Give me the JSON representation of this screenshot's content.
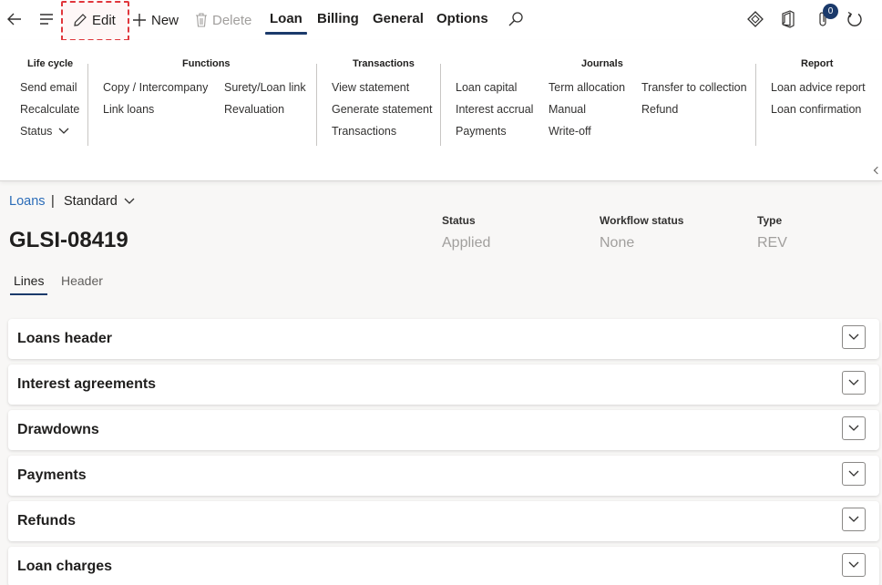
{
  "toolbar": {
    "edit_label": "Edit",
    "new_label": "New",
    "delete_label": "Delete",
    "tabs": [
      "Loan",
      "Billing",
      "General",
      "Options"
    ],
    "notification_count": "0"
  },
  "ribbon": {
    "groups": {
      "lifecycle": {
        "title": "Life cycle",
        "items": [
          "Send email",
          "Recalculate",
          "Status"
        ]
      },
      "functions": {
        "title": "Functions",
        "items": [
          "Copy / Intercompany",
          "Link loans",
          "Surety/Loan link",
          "Revaluation"
        ]
      },
      "transactions": {
        "title": "Transactions",
        "items": [
          "View statement",
          "Generate statement",
          "Transactions"
        ]
      },
      "journals": {
        "title": "Journals",
        "items": [
          "Loan capital",
          "Interest accrual",
          "Payments",
          "Term allocation",
          "Manual",
          "Write-off",
          "Transfer to collection",
          "Refund"
        ]
      },
      "report": {
        "title": "Report",
        "items": [
          "Loan advice report",
          "Loan confirmation"
        ]
      }
    }
  },
  "page": {
    "breadcrumb": "Loans",
    "separator": "|",
    "view": "Standard",
    "record_id": "GLSI-08419",
    "fields": [
      {
        "label": "Status",
        "value": "Applied"
      },
      {
        "label": "Workflow status",
        "value": "None"
      },
      {
        "label": "Type",
        "value": "REV"
      }
    ],
    "subtabs": [
      "Lines",
      "Header"
    ]
  },
  "sections": [
    "Loans header",
    "Interest agreements",
    "Drawdowns",
    "Payments",
    "Refunds",
    "Loan charges"
  ]
}
